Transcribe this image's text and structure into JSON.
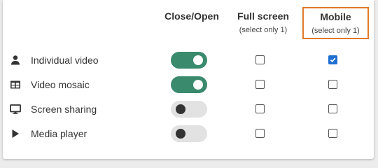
{
  "columns": {
    "close_open": {
      "title": "Close/Open"
    },
    "full_screen": {
      "title": "Full screen",
      "subtitle": "(select only 1)"
    },
    "mobile": {
      "title": "Mobile",
      "subtitle": "(select only 1)"
    }
  },
  "rows": [
    {
      "label": "Individual video",
      "icon": "person-icon",
      "open": true,
      "full_screen": false,
      "mobile": true
    },
    {
      "label": "Video mosaic",
      "icon": "grid-icon",
      "open": true,
      "full_screen": false,
      "mobile": false
    },
    {
      "label": "Screen sharing",
      "icon": "monitor-icon",
      "open": false,
      "full_screen": false,
      "mobile": false
    },
    {
      "label": "Media player",
      "icon": "play-icon",
      "open": false,
      "full_screen": false,
      "mobile": false
    }
  ],
  "colors": {
    "toggle_on": "#3a8a6e",
    "toggle_off": "#e2e2e2",
    "checkbox_checked": "#1f6fd1",
    "highlight_border": "#e07a2a"
  }
}
